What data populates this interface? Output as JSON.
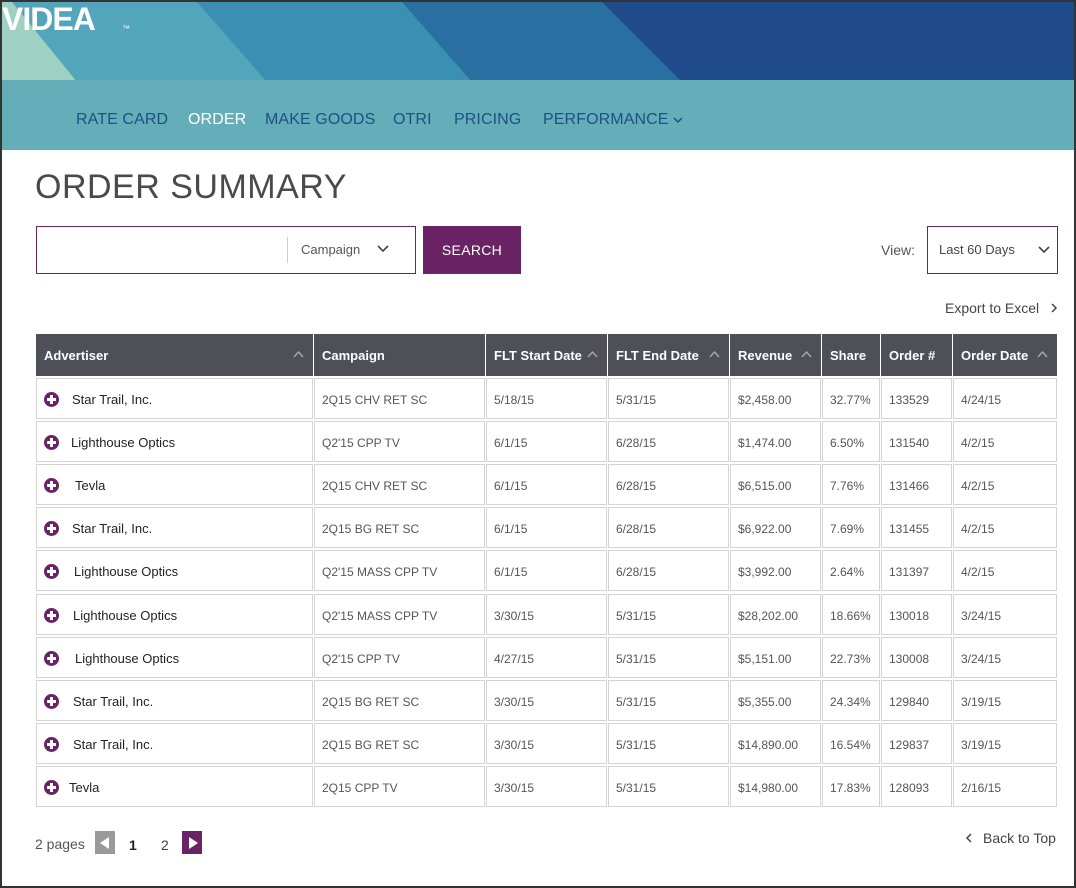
{
  "brand": {
    "logo_text": "VIDEA",
    "trademark": "™"
  },
  "nav": {
    "items": [
      {
        "label": "RATE CARD"
      },
      {
        "label": "ORDER"
      },
      {
        "label": "MAKE GOODS"
      },
      {
        "label": "OTRI"
      },
      {
        "label": "PRICING"
      },
      {
        "label": "PERFORMANCE"
      }
    ],
    "active": "ORDER"
  },
  "page": {
    "title": "ORDER SUMMARY"
  },
  "search": {
    "value": "",
    "placeholder": "",
    "field_select": "Campaign",
    "button_label": "SEARCH"
  },
  "view": {
    "label": "View:",
    "selected": "Last 60 Days"
  },
  "export": {
    "label": "Export to Excel"
  },
  "table": {
    "columns": [
      {
        "label": "Advertiser",
        "sortable": true
      },
      {
        "label": "Campaign",
        "sortable": false
      },
      {
        "label": "FLT Start Date",
        "sortable": true
      },
      {
        "label": "FLT End Date",
        "sortable": true
      },
      {
        "label": "Revenue",
        "sortable": true
      },
      {
        "label": "Share",
        "sortable": false
      },
      {
        "label": "Order #",
        "sortable": false
      },
      {
        "label": "Order Date",
        "sortable": true
      }
    ],
    "rows": [
      {
        "advertiser": "Star Trail, Inc.",
        "campaign": "2Q15 CHV RET SC",
        "start": "5/18/15",
        "end": "5/31/15",
        "revenue": "$2,458.00",
        "share": "32.77%",
        "order": "133529",
        "order_date": "4/24/15"
      },
      {
        "advertiser": "Lighthouse Optics",
        "campaign": "Q2'15  CPP TV",
        "start": "6/1/15",
        "end": "6/28/15",
        "revenue": "$1,474.00",
        "share": "6.50%",
        "order": "131540",
        "order_date": "4/2/15"
      },
      {
        "advertiser": "Tevla",
        "campaign": "2Q15 CHV RET SC",
        "start": "6/1/15",
        "end": "6/28/15",
        "revenue": "$6,515.00",
        "share": "7.76%",
        "order": "131466",
        "order_date": "4/2/15"
      },
      {
        "advertiser": "Star Trail, Inc.",
        "campaign": "2Q15 BG  RET SC",
        "start": "6/1/15",
        "end": "6/28/15",
        "revenue": "$6,922.00",
        "share": "7.69%",
        "order": "131455",
        "order_date": "4/2/15"
      },
      {
        "advertiser": "Lighthouse Optics",
        "campaign": "Q2'15 MASS CPP TV",
        "start": "6/1/15",
        "end": "6/28/15",
        "revenue": "$3,992.00",
        "share": "2.64%",
        "order": "131397",
        "order_date": "4/2/15"
      },
      {
        "advertiser": "Lighthouse Optics",
        "campaign": "Q2'15 MASS CPP TV",
        "start": "3/30/15",
        "end": "5/31/15",
        "revenue": "$28,202.00",
        "share": "18.66%",
        "order": "130018",
        "order_date": "3/24/15"
      },
      {
        "advertiser": "Lighthouse Optics",
        "campaign": "Q2'15 CPP TV",
        "start": "4/27/15",
        "end": "5/31/15",
        "revenue": "$5,151.00",
        "share": "22.73%",
        "order": "130008",
        "order_date": "3/24/15"
      },
      {
        "advertiser": "Star Trail, Inc.",
        "campaign": "2Q15 BG  RET SC",
        "start": "3/30/15",
        "end": "5/31/15",
        "revenue": "$5,355.00",
        "share": "24.34%",
        "order": "129840",
        "order_date": "3/19/15"
      },
      {
        "advertiser": "Star Trail, Inc.",
        "campaign": "2Q15 BG  RET SC",
        "start": "3/30/15",
        "end": "5/31/15",
        "revenue": "$14,890.00",
        "share": "16.54%",
        "order": "129837",
        "order_date": "3/19/15"
      },
      {
        "advertiser": "Tevla",
        "campaign": "2Q15  CPP TV",
        "start": "3/30/15",
        "end": "5/31/15",
        "revenue": "$14,980.00",
        "share": "17.83%",
        "order": "128093",
        "order_date": "2/16/15"
      }
    ]
  },
  "pagination": {
    "pages_label": "2 pages",
    "pages": [
      "1",
      "2"
    ],
    "current": "1"
  },
  "back_to_top": {
    "label": "Back to Top"
  },
  "colors": {
    "accent": "#6a2466",
    "nav_bg": "#63aeb9",
    "nav_link": "#1f4f84",
    "header_bg": "#4e4f57"
  },
  "icons": {
    "expand": "plus-circle-icon",
    "sort": "sort-caret-up-icon",
    "dropdown": "chevron-down-icon"
  }
}
